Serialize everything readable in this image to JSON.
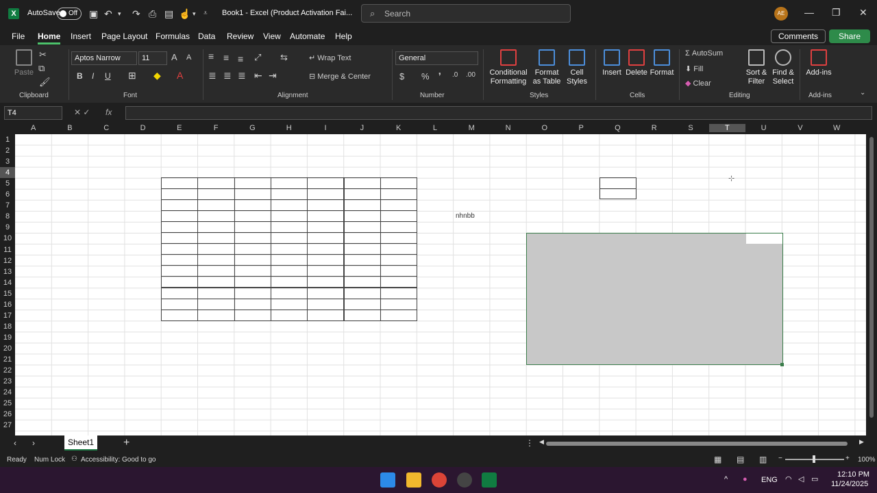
{
  "titlebar": {
    "autosave_label": "AutoSave",
    "autosave_state": "Off",
    "document_title": "Book1 - Excel (Product Activation Fai...",
    "search_placeholder": "Search",
    "user_initials": "AE"
  },
  "menu": {
    "tabs": [
      "File",
      "Home",
      "Insert",
      "Page Layout",
      "Formulas",
      "Data",
      "Review",
      "View",
      "Automate",
      "Help"
    ],
    "active": "Home",
    "comments_label": "Comments",
    "share_label": "Share"
  },
  "ribbon": {
    "clipboard": {
      "paste": "Paste",
      "label": "Clipboard"
    },
    "font": {
      "name": "Aptos Narrow",
      "size": "11",
      "label": "Font",
      "bold": "B",
      "italic": "I",
      "underline": "U"
    },
    "alignment": {
      "wrap": "Wrap Text",
      "merge": "Merge & Center",
      "label": "Alignment"
    },
    "number": {
      "format": "General",
      "label": "Number",
      "currency": "$",
      "percent": "%"
    },
    "styles": {
      "conditional": "Conditional Formatting",
      "format_table": "Format as Table",
      "cell_styles": "Cell Styles",
      "label": "Styles"
    },
    "cells": {
      "insert": "Insert",
      "delete": "Delete",
      "format": "Format",
      "label": "Cells"
    },
    "editing": {
      "autosum": "AutoSum",
      "fill": "Fill",
      "clear": "Clear",
      "sort": "Sort & Filter",
      "find": "Find & Select",
      "label": "Editing"
    },
    "addins": {
      "button": "Add-ins",
      "label": "Add-ins"
    }
  },
  "formula_bar": {
    "name_box": "T4",
    "fx": "fx",
    "formula": ""
  },
  "grid": {
    "columns": [
      "A",
      "B",
      "C",
      "D",
      "E",
      "F",
      "G",
      "H",
      "I",
      "J",
      "K",
      "L",
      "M",
      "N",
      "O",
      "P",
      "Q",
      "R",
      "S",
      "T",
      "U",
      "V",
      "W"
    ],
    "selected_column": "T",
    "rows": [
      "1",
      "2",
      "3",
      "4",
      "5",
      "6",
      "7",
      "8",
      "9",
      "10",
      "11",
      "12",
      "13",
      "14",
      "15",
      "16",
      "17",
      "18",
      "19",
      "20",
      "21",
      "22",
      "23",
      "24",
      "25",
      "26",
      "27"
    ],
    "selected_row": "4",
    "cell_text": "nhnbb"
  },
  "sheets": {
    "tabs": [
      "Sheet1"
    ],
    "add": "+"
  },
  "status": {
    "ready": "Ready",
    "numlock": "Num Lock",
    "accessibility": "Accessibility: Good to go",
    "zoom": "100%"
  },
  "taskbar": {
    "lang": "ENG",
    "time": "12:10 PM",
    "date": "11/24/2025"
  },
  "colors": {
    "excel_green": "#107c41",
    "selection_green": "#3a7d4a",
    "selection_fill": "#c8c8c8",
    "taskbar": "#2b1630"
  }
}
